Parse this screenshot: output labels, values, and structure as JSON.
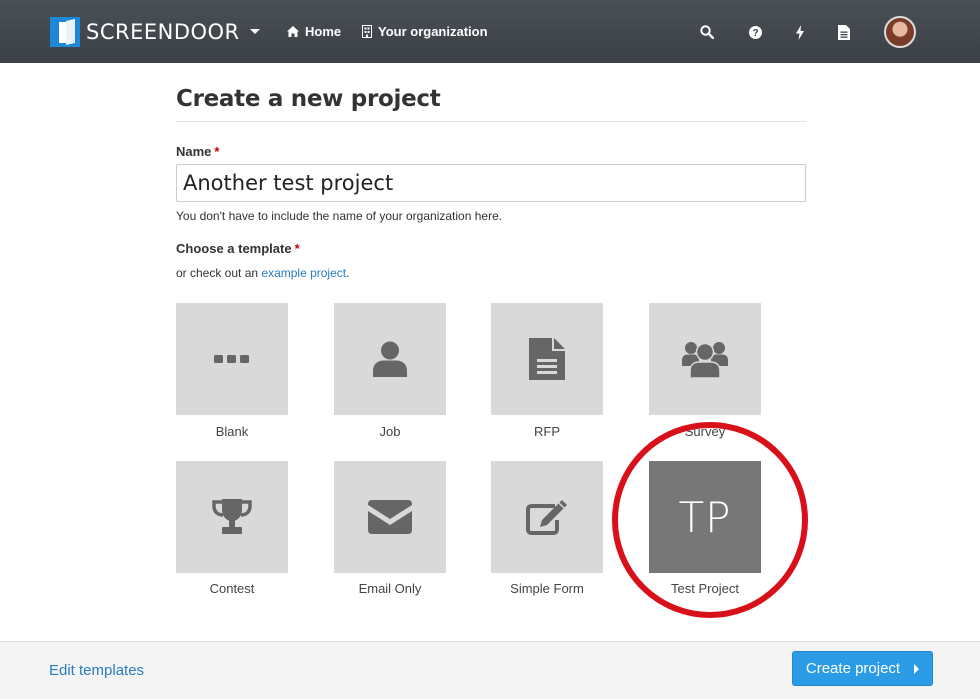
{
  "navbar": {
    "brand": "SCREENDOOR",
    "home_label": "Home",
    "org_label": "Your organization"
  },
  "page": {
    "title": "Create a new project"
  },
  "form": {
    "name_label": "Name",
    "required_marker": "*",
    "name_value": "Another test project",
    "name_help": "You don't have to include the name of your organization here.",
    "template_label": "Choose a template",
    "template_help_prefix": "or check out an ",
    "template_help_link": "example project",
    "template_help_suffix": "."
  },
  "templates": [
    {
      "label": "Blank",
      "icon": "ellipsis-icon"
    },
    {
      "label": "Job",
      "icon": "user-icon"
    },
    {
      "label": "RFP",
      "icon": "document-icon"
    },
    {
      "label": "Survey",
      "icon": "group-icon"
    },
    {
      "label": "Contest",
      "icon": "trophy-icon"
    },
    {
      "label": "Email Only",
      "icon": "envelope-icon"
    },
    {
      "label": "Simple Form",
      "icon": "edit-icon"
    },
    {
      "label": "Test Project",
      "initials": "TP",
      "selected": true
    }
  ],
  "footer": {
    "edit_templates": "Edit templates",
    "create_project": "Create project"
  },
  "colors": {
    "navbar": "#3f454b",
    "primary": "#2b9be6",
    "link": "#2a7bbf",
    "annotation": "#d8101a"
  }
}
